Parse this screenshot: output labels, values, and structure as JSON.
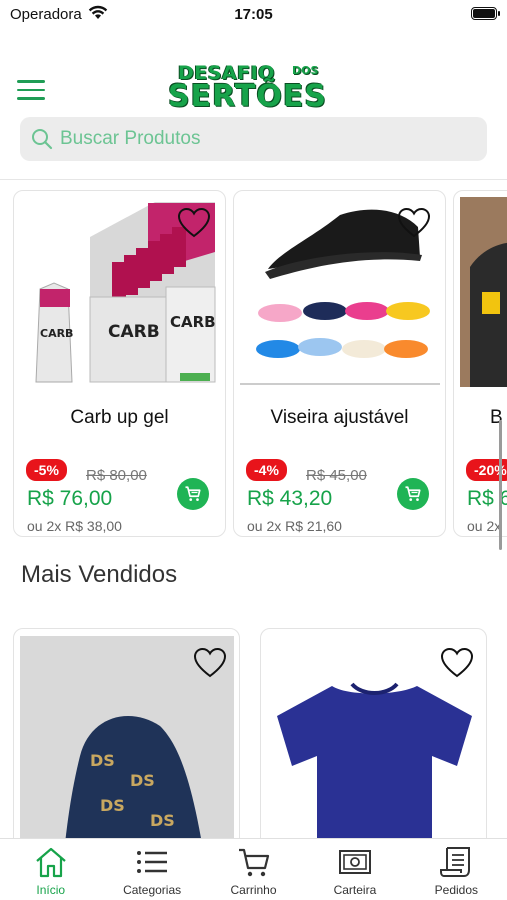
{
  "status_bar": {
    "carrier": "Operadora",
    "time": "17:05"
  },
  "header": {
    "logo_line1": "DESAFIO",
    "logo_small": "DOS",
    "logo_line2": "SERTÕES"
  },
  "search": {
    "placeholder": "Buscar Produtos"
  },
  "products": [
    {
      "name": "Carb up gel",
      "discount": "-5%",
      "old_price": "R$ 80,00",
      "price": "R$ 76,00",
      "installments": "ou 2x R$ 38,00",
      "image": "carb-gel-box"
    },
    {
      "name": "Viseira ajustável",
      "discount": "-4%",
      "old_price": "R$ 45,00",
      "price": "R$ 43,20",
      "installments": "ou 2x R$ 21,60",
      "image": "visors"
    },
    {
      "name": "B",
      "discount": "-20%",
      "old_price": "",
      "price": "R$ 6",
      "installments": "ou 2x",
      "image": "black-cap"
    }
  ],
  "best_sellers": {
    "title": "Mais Vendidos",
    "items": [
      {
        "image": "printed-scarf"
      },
      {
        "image": "blue-tshirt"
      }
    ]
  },
  "tabs": [
    {
      "label": "Início",
      "icon": "home-icon",
      "active": true
    },
    {
      "label": "Categorias",
      "icon": "list-icon",
      "active": false
    },
    {
      "label": "Carrinho",
      "icon": "cart-icon",
      "active": false
    },
    {
      "label": "Carteira",
      "icon": "wallet-icon",
      "active": false
    },
    {
      "label": "Pedidos",
      "icon": "receipt-icon",
      "active": false
    }
  ],
  "colors": {
    "accent": "#17a34a",
    "discount": "#e8141b",
    "cart_button": "#1fb455"
  }
}
